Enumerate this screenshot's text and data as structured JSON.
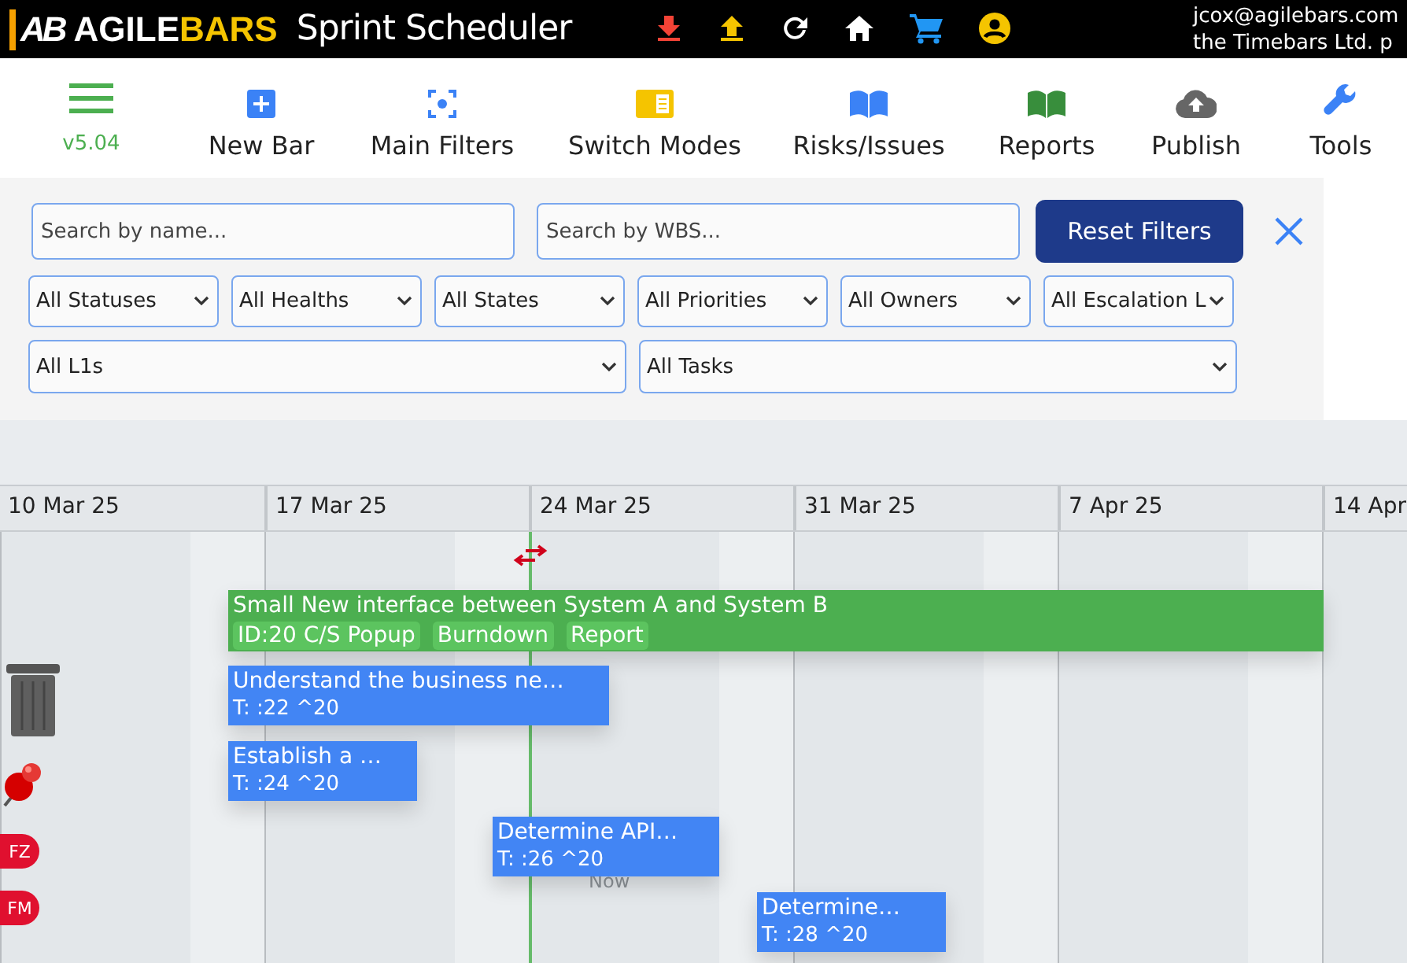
{
  "header": {
    "logo_mark": "AB",
    "logo_primary": "AGILE",
    "logo_accent": "BARS",
    "app_title": "Sprint Scheduler",
    "user_email": "jcox@agilebars.com",
    "company": "the Timebars Ltd. p"
  },
  "toolbar": {
    "version": "v5.04",
    "items": [
      {
        "kind": "new",
        "label": "New Bar"
      },
      {
        "kind": "filters",
        "label": "Main Filters"
      },
      {
        "kind": "modes",
        "label": "Switch Modes"
      },
      {
        "kind": "risks",
        "label": "Risks/Issues"
      },
      {
        "kind": "reports",
        "label": "Reports"
      },
      {
        "kind": "publish",
        "label": "Publish"
      },
      {
        "kind": "tools",
        "label": "Tools"
      }
    ]
  },
  "filters": {
    "search_fields": [
      {
        "placeholder": "Search by name..."
      },
      {
        "placeholder": "Search by WBS..."
      }
    ],
    "reset_button": "Reset Filters",
    "dropdowns": [
      {
        "value": "All Statuses"
      },
      {
        "value": "All Healths"
      },
      {
        "value": "All States"
      },
      {
        "value": "All Priorities"
      },
      {
        "value": "All Owners"
      },
      {
        "value": "All Escalation L"
      }
    ],
    "wide_dropdowns": [
      {
        "value": "All L1s"
      },
      {
        "value": "All Tasks"
      }
    ]
  },
  "timeline": {
    "weeks": [
      "10 Mar 25",
      "17 Mar 25",
      "24 Mar 25",
      "31 Mar 25",
      "7 Apr 25",
      "14 Apr"
    ],
    "now_label": "Now",
    "bars": [
      {
        "kind": "feature",
        "title": "Small New interface between System A and System B",
        "tags": [
          "ID:20 C/S Popup",
          "Burndown",
          "Report"
        ]
      },
      {
        "kind": "task",
        "title": "Understand the business ne…",
        "subtitle": "T: :22 ^20"
      },
      {
        "kind": "task",
        "title": "Establish a …",
        "subtitle": "T: :24 ^20"
      },
      {
        "kind": "task",
        "title": "Determine API…",
        "subtitle": "T: :26 ^20"
      },
      {
        "kind": "task",
        "title": "Determine…",
        "subtitle": "T: :28 ^20"
      }
    ],
    "people": [
      {
        "initials": "FZ",
        "color": "#e0102f"
      },
      {
        "initials": "FM",
        "color": "#e0102f"
      }
    ]
  }
}
